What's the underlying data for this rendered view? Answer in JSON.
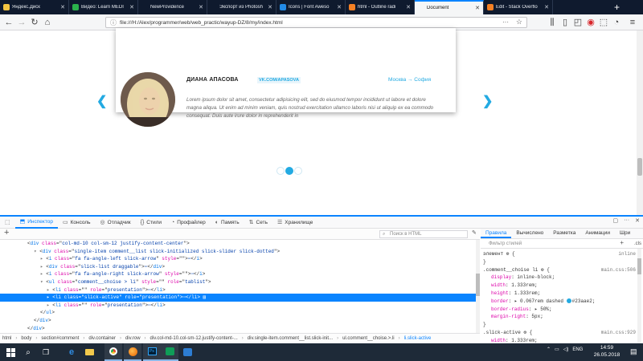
{
  "browser": {
    "tabs": [
      {
        "label": "Яндекс.Диск",
        "favicon_color": "#f4c542",
        "active": false
      },
      {
        "label": "Видео: Learn MEDI",
        "favicon_color": "#2bb24c",
        "active": false
      },
      {
        "label": "NewProvidence",
        "favicon_color": "#0f1a2e",
        "active": false
      },
      {
        "label": "Экспорт из Photosh",
        "favicon_color": "#0f1a2e",
        "active": false
      },
      {
        "label": "Icons | Font Aweso",
        "favicon_color": "#228ae6",
        "active": false
      },
      {
        "label": "html - Outline radi",
        "favicon_color": "#f48024",
        "active": false
      },
      {
        "label": "Document",
        "favicon_color": "#f5f6f7",
        "active": true
      },
      {
        "label": "Edit - Stack Overflo",
        "favicon_color": "#f48024",
        "active": false
      }
    ],
    "new_tab": "+",
    "url": "file:///H:/Alex/programmer/web/web_practic/wayup-DZ/8/my/index.html",
    "url_more": "···",
    "url_star": "☆"
  },
  "testimonial": {
    "name": "ДИАНА АПАСОВА",
    "link": "VK.COM/APASOVA",
    "city": "Москва → София",
    "text": "Lorem ipsum dolor sit amet, consectetur adipisicing elit, sed do eiusmod tempor incididunt ut labore et dolore magna aliqua. Ut enim ad minim veniam, quis nostrud exercitation ullamco laboris nisi ut aliquip ex ea commodo consequat. Duis aute irure dolor in reprehenderit in",
    "accent_color": "#23aae2",
    "prev_arrow": "❮",
    "next_arrow": "❯",
    "dots_total": 3,
    "active_dot": 2
  },
  "devtools": {
    "tabs": [
      {
        "icon": "⬚",
        "label": "",
        "active": false
      },
      {
        "icon": "⬒",
        "label": "Инспектор",
        "active": true
      },
      {
        "icon": "▭",
        "label": "Консоль",
        "active": false
      },
      {
        "icon": "◎",
        "label": "Отладчик",
        "active": false
      },
      {
        "icon": "{}",
        "label": "Стили",
        "active": false
      },
      {
        "icon": "◔",
        "label": "Профайлер",
        "active": false
      },
      {
        "icon": "◐",
        "label": "Память",
        "active": false
      },
      {
        "icon": "⇅",
        "label": "Сеть",
        "active": false
      },
      {
        "icon": "☰",
        "label": "Хранилище",
        "active": false
      }
    ],
    "search_placeholder": "Поиск в HTML",
    "markup_lines": [
      {
        "indent": 4,
        "tw": "",
        "html": "&lt;<span class='tag'>div</span> <span class='an'>class</span>=\"<span class='av'>col-md-10 col-sm-12 justify-content-center</span>\"&gt;"
      },
      {
        "indent": 5,
        "tw": "▾",
        "html": "&lt;<span class='tag'>div</span> <span class='an'>class</span>=\"<span class='av'>single-item comment__list slick-initialized slick-slider slick-dotted</span>\"&gt;"
      },
      {
        "indent": 6,
        "tw": "▸",
        "html": "&lt;<span class='tag'>i</span> <span class='an'>class</span>=\"<span class='av'>fa fa-angle-left slick-arrow</span>\" <span class='an'>style</span>=\"\"&gt;<span class='av'>⋯</span>&lt;/<span class='tag'>i</span>&gt;"
      },
      {
        "indent": 6,
        "tw": "▸",
        "html": "&lt;<span class='tag'>div</span> <span class='an'>class</span>=\"<span class='av'>slick-list draggable</span>\"&gt;<span class='av'>⋯</span>&lt;/<span class='tag'>div</span>&gt;"
      },
      {
        "indent": 6,
        "tw": "▸",
        "html": "&lt;<span class='tag'>i</span> <span class='an'>class</span>=\"<span class='av'>fa fa-angle-right slick-arrow</span>\" <span class='an'>style</span>=\"\"&gt;<span class='av'>⋯</span>&lt;/<span class='tag'>i</span>&gt;"
      },
      {
        "indent": 6,
        "tw": "▾",
        "html": "&lt;<span class='tag'>ul</span> <span class='an'>class</span>=\"<span class='av'>comment__choise &gt; li</span>\" <span class='an'>style</span>=\"\" <span class='an'>role</span>=\"<span class='av'>tablist</span>\"&gt;"
      },
      {
        "indent": 7,
        "tw": "▸",
        "html": "&lt;<span class='tag'>li</span> <span class='an'>class</span>=\"\" <span class='an'>role</span>=\"<span class='av'>presentation</span>\"&gt;<span class='av'>⋯</span>&lt;/<span class='tag'>li</span>&gt;"
      },
      {
        "indent": 7,
        "tw": "▸",
        "sel": true,
        "html": "&lt;<span class='tag'>li</span> <span class='an'>class</span>=\"<span class='av'>slick-active</span>\" <span class='an'>role</span>=\"<span class='av'>presentation</span>\"&gt;<span class='av'>⋯</span>&lt;/<span class='tag'>li</span>&gt; ▤"
      },
      {
        "indent": 7,
        "tw": "▸",
        "html": "&lt;<span class='tag'>li</span> <span class='an'>class</span>=\"\" <span class='an'>role</span>=\"<span class='av'>presentation</span>\"&gt;<span class='av'>⋯</span>&lt;/<span class='tag'>li</span>&gt;"
      },
      {
        "indent": 6,
        "tw": "",
        "html": "&lt;/<span class='tag'>ul</span>&gt;"
      },
      {
        "indent": 5,
        "tw": "",
        "html": "&lt;/<span class='tag'>div</span>&gt;"
      },
      {
        "indent": 4,
        "tw": "",
        "html": "&lt;/<span class='tag'>div</span>&gt;"
      }
    ],
    "breadcrumbs": [
      "html",
      "body",
      "section#comment",
      "div.container",
      "div.row",
      "div.col-md-10.col-sm-12.justify-content-...",
      "div.single-item.comment__list.slick-init...",
      "ul.comment__choise.>.li",
      "li.slick-active"
    ],
    "rules_tabs": [
      "Правила",
      "Вычислено",
      "Разметка",
      "Анимации",
      "Шри"
    ],
    "filter_placeholder": "Фильтр стилей",
    "filter_plus": "+",
    "filter_cls": ".cls",
    "rule_lines": [
      {
        "kind": "sel",
        "text": "элемент ⚙ {",
        "src": "inline"
      },
      {
        "kind": "plain",
        "text": "}"
      },
      {
        "kind": "sel",
        "text": ".comment__choise li ⚙ {",
        "src": "main.css:506"
      },
      {
        "kind": "decl",
        "prop": "display",
        "val": "inline-block;"
      },
      {
        "kind": "decl",
        "prop": "width",
        "val": "1.333rem;"
      },
      {
        "kind": "decl",
        "prop": "height",
        "val": "1.333rem;"
      },
      {
        "kind": "decl",
        "prop": "border",
        "val": "▸ 0.067rem dashed ",
        "swatch": "#23aae2",
        "val2": "#23aae2;"
      },
      {
        "kind": "decl",
        "prop": "border-radius",
        "val": "▸ 50%;"
      },
      {
        "kind": "decl",
        "prop": "margin-right",
        "val": "5px;"
      },
      {
        "kind": "plain",
        "text": "}"
      },
      {
        "kind": "sel",
        "text": ".slick-active ⚙ {",
        "src": "main.css:929"
      },
      {
        "kind": "decl",
        "prop": "width",
        "val": "1.333rem;"
      }
    ]
  },
  "taskbar": {
    "lang": "ENG",
    "time": "14:59",
    "date": "26.05.2018"
  }
}
